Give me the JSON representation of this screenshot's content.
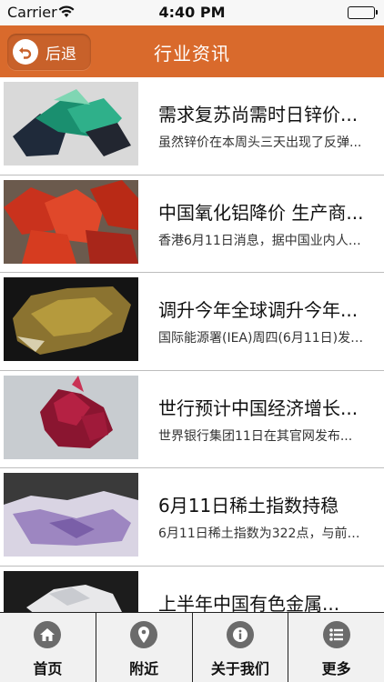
{
  "status_bar": {
    "carrier": "Carrier",
    "time": "4:40 PM"
  },
  "nav": {
    "back_label": "后退",
    "title": "行业资讯"
  },
  "news": [
    {
      "title": "需求复苏尚需时日锌价...",
      "summary": "虽然锌价在本周头三天出现了反弹..."
    },
    {
      "title": "中国氧化铝降价 生产商...",
      "summary": "香港6月11日消息，据中国业内人士..."
    },
    {
      "title": "调升今年全球调升今年...",
      "summary": "国际能源署(IEA)周四(6月11日)发布..."
    },
    {
      "title": "世行预计中国经济增长...",
      "summary": "世界银行集团11日在其官网发布..."
    },
    {
      "title": "6月11日稀土指数持稳",
      "summary": "6月11日稀土指数为322点，与前一..."
    },
    {
      "title": "上半年中国有色金属...",
      "summary": ""
    }
  ],
  "tabs": [
    {
      "label": "首页",
      "icon": "home-icon"
    },
    {
      "label": "附近",
      "icon": "location-pin-icon"
    },
    {
      "label": "关于我们",
      "icon": "info-icon"
    },
    {
      "label": "更多",
      "icon": "more-list-icon"
    }
  ],
  "colors": {
    "nav_background": "#d96a2c",
    "tab_icon": "#6b6b6b"
  }
}
